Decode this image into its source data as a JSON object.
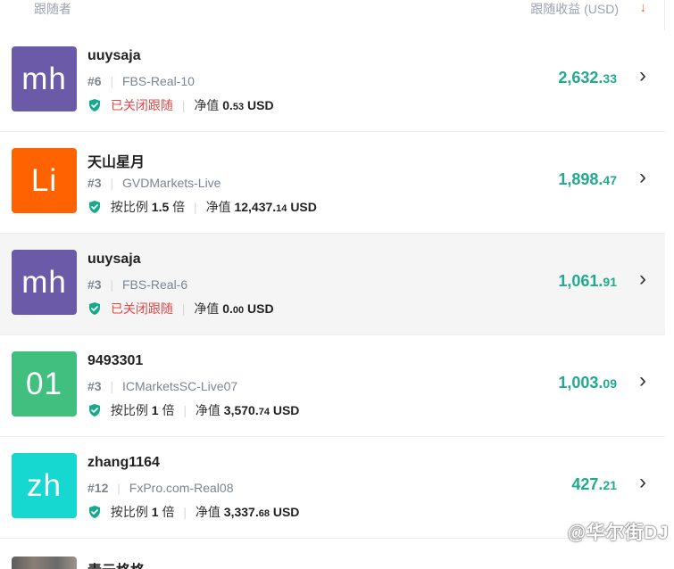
{
  "header": {
    "left_label": "跟随者",
    "right_label": "跟随收益 (USD)",
    "sort_icon": "down-arrow-icon"
  },
  "rows": [
    {
      "avatar": {
        "text": "mh",
        "color": "#6a5aa8"
      },
      "name": "uuysaja",
      "rank": "#6",
      "server": "FBS-Real-10",
      "status": "已关闭跟随",
      "equity_label": "净值",
      "equity_main": "0.",
      "equity_dec": "53",
      "equity_unit": "USD",
      "profit_main": "2,632.",
      "profit_dec": "33",
      "selected": false
    },
    {
      "avatar": {
        "text": "Li",
        "color": "#ff6200"
      },
      "name": "天山星月",
      "rank": "#3",
      "server": "GVDMarkets-Live",
      "status": "按比例",
      "ratio": "1.5",
      "ratio_unit": "倍",
      "equity_label": "净值",
      "equity_main": "12,437.",
      "equity_dec": "14",
      "equity_unit": "USD",
      "profit_main": "1,898.",
      "profit_dec": "47",
      "selected": false
    },
    {
      "avatar": {
        "text": "mh",
        "color": "#6a5aa8"
      },
      "name": "uuysaja",
      "rank": "#3",
      "server": "FBS-Real-6",
      "status": "已关闭跟随",
      "equity_label": "净值",
      "equity_main": "0.",
      "equity_dec": "00",
      "equity_unit": "USD",
      "profit_main": "1,061.",
      "profit_dec": "91",
      "selected": true
    },
    {
      "avatar": {
        "text": "01",
        "color": "#41bf7e"
      },
      "name": "9493301",
      "rank": "#3",
      "server": "ICMarketsSC-Live07",
      "status": "按比例",
      "ratio": "1",
      "ratio_unit": "倍",
      "equity_label": "净值",
      "equity_main": "3,570.",
      "equity_dec": "74",
      "equity_unit": "USD",
      "profit_main": "1,003.",
      "profit_dec": "09",
      "selected": false
    },
    {
      "avatar": {
        "text": "zh",
        "color": "#16d8d0"
      },
      "name": "zhang1164",
      "rank": "#12",
      "server": "FxPro.com-Real08",
      "status": "按比例",
      "ratio": "1",
      "ratio_unit": "倍",
      "equity_label": "净值",
      "equity_main": "3,337.",
      "equity_dec": "68",
      "equity_unit": "USD",
      "profit_main": "427.",
      "profit_dec": "21",
      "selected": false
    }
  ],
  "partial_row": {
    "name": "青云格格"
  },
  "watermark": "@华尔街DJ",
  "colors": {
    "profit": "#20aa8e",
    "closed_status": "#e04848",
    "shield": "#18a88c"
  }
}
